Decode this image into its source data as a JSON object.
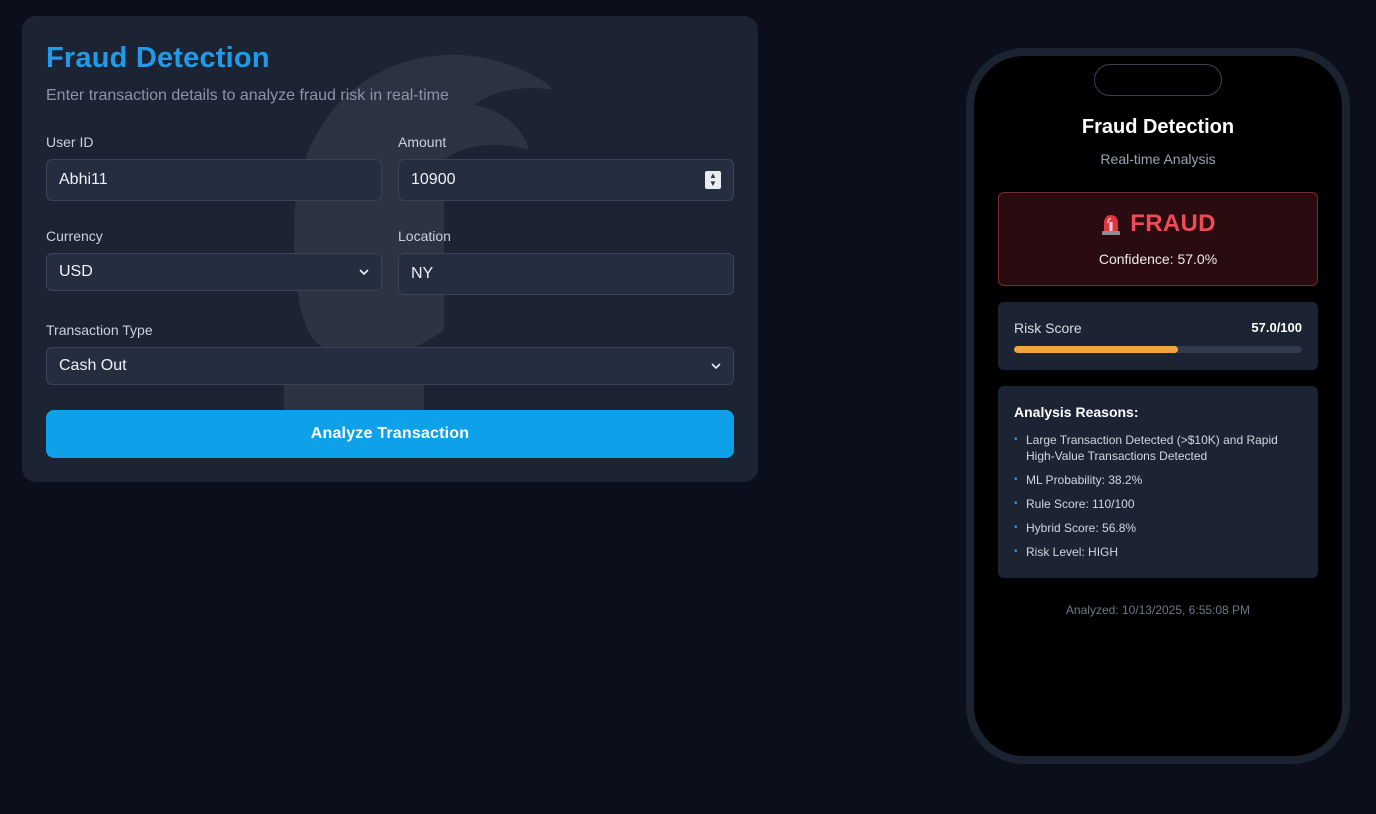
{
  "form": {
    "title": "Fraud Detection",
    "subtitle": "Enter transaction details to analyze fraud risk in real-time",
    "user_id": {
      "label": "User ID",
      "value": "Abhi11"
    },
    "amount": {
      "label": "Amount",
      "value": "10900"
    },
    "currency": {
      "label": "Currency",
      "value": "USD"
    },
    "location": {
      "label": "Location",
      "value": "NY"
    },
    "transaction_type": {
      "label": "Transaction Type",
      "value": "Cash Out"
    },
    "submit_label": "Analyze Transaction"
  },
  "phone": {
    "title": "Fraud Detection",
    "subtitle": "Real-time Analysis",
    "verdict": {
      "icon": "siren-icon",
      "label": "FRAUD",
      "confidence": "Confidence: 57.0%",
      "color": "#f04a56"
    },
    "risk": {
      "label": "Risk Score",
      "value_text": "57.0/100",
      "fraction": 0.57,
      "color": "#f0a63a"
    },
    "reasons": {
      "title": "Analysis Reasons:",
      "items": [
        "Large Transaction Detected (>$10K) and Rapid High-Value Transactions Detected",
        "ML Probability: 38.2%",
        "Rule Score: 110/100",
        "Hybrid Score: 56.8%",
        "Risk Level: HIGH"
      ]
    },
    "analyzed": "Analyzed: 10/13/2025, 6:55:08 PM"
  },
  "colors": {
    "accent": "#1e9be9",
    "button": "#0ea1ea",
    "background": "#0a0f1b",
    "card": "#1c2433"
  }
}
